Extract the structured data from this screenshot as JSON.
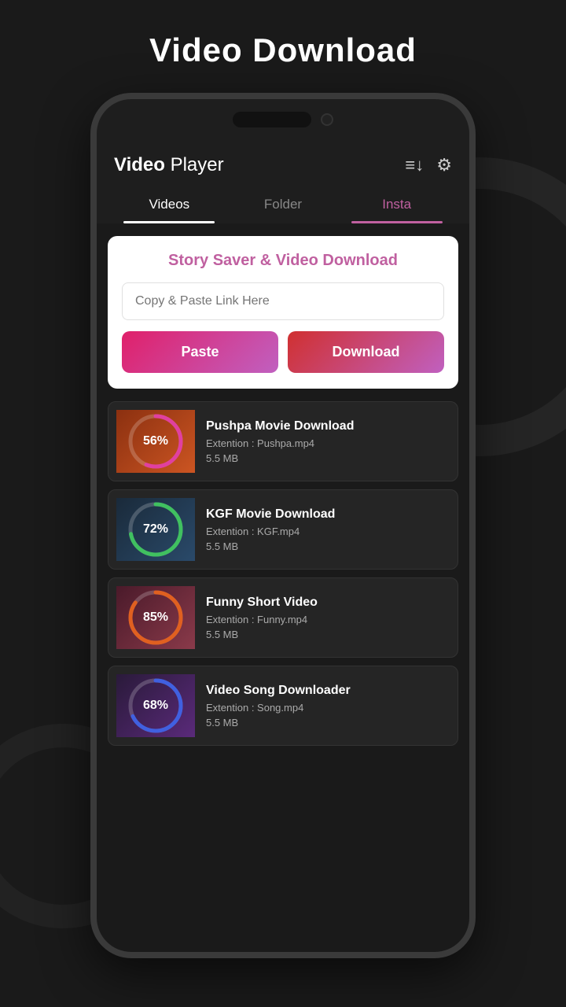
{
  "page": {
    "title": "Video Download"
  },
  "app": {
    "header_title_bold": "Video",
    "header_title_regular": " Player"
  },
  "tabs": [
    {
      "id": "videos",
      "label": "Videos",
      "active": true
    },
    {
      "id": "folder",
      "label": "Folder",
      "active": false
    },
    {
      "id": "insta",
      "label": "Insta",
      "active": false,
      "special": true
    }
  ],
  "story_card": {
    "title_part1": "Story Saver",
    "title_part2": " & Video Download",
    "input_placeholder": "Copy & Paste Link Here",
    "btn_paste": "Paste",
    "btn_download": "Download"
  },
  "downloads": [
    {
      "id": 1,
      "title": "Pushpa Movie Download",
      "extension": "Extention : Pushpa.mp4",
      "size": "5.5 MB",
      "percent": 56,
      "color1": "#e040a0",
      "color2": "#c040a0",
      "thumb_class": "thumb-1"
    },
    {
      "id": 2,
      "title": "KGF Movie Download",
      "extension": "Extention : KGF.mp4",
      "size": "5.5 MB",
      "percent": 72,
      "color1": "#40c060",
      "color2": "#20a040",
      "thumb_class": "thumb-2"
    },
    {
      "id": 3,
      "title": "Funny Short Video",
      "extension": "Extention : Funny.mp4",
      "size": "5.5 MB",
      "percent": 85,
      "color1": "#e06020",
      "color2": "#e08040",
      "thumb_class": "thumb-3"
    },
    {
      "id": 4,
      "title": "Video Song Downloader",
      "extension": "Extention : Song.mp4",
      "size": "5.5 MB",
      "percent": 68,
      "color1": "#4060e0",
      "color2": "#6040c0",
      "thumb_class": "thumb-4"
    }
  ],
  "icons": {
    "sort": "≡↓",
    "settings": "⚙"
  }
}
